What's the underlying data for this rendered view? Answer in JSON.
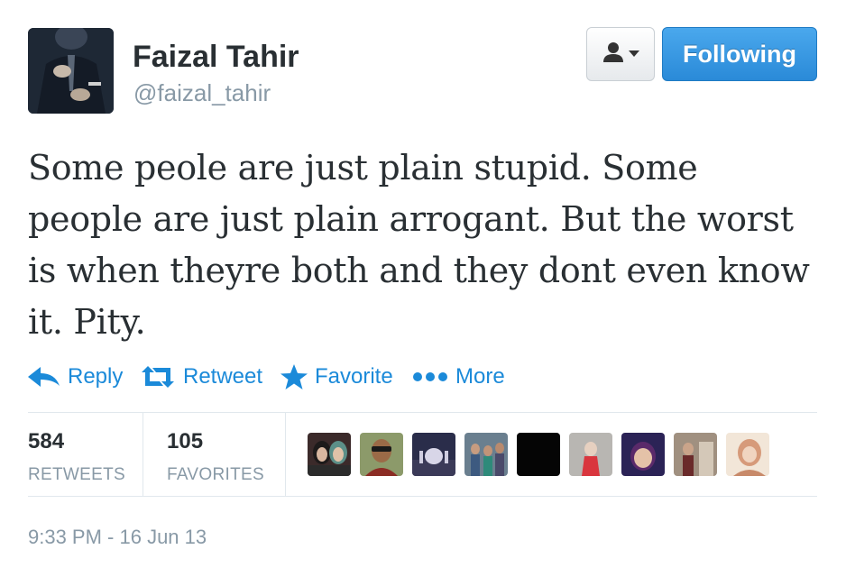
{
  "user": {
    "name": "Faizal Tahir",
    "handle": "@faizal_tahir"
  },
  "header": {
    "follow_label": "Following"
  },
  "tweet": {
    "text": "Some peole are just plain stupid. Some people are just plain arrogant. But the worst is when theyre both and they dont even know it. Pity."
  },
  "actions": {
    "reply": "Reply",
    "retweet": "Retweet",
    "favorite": "Favorite",
    "more": "More"
  },
  "stats": {
    "retweets_count": "584",
    "retweets_label": "RETWEETS",
    "favorites_count": "105",
    "favorites_label": "FAVORITES"
  },
  "timestamp": "9:33 PM - 16 Jun 13",
  "colors": {
    "accent": "#1b8ad9",
    "follow_button": "#2a8ad8",
    "muted": "#8899a6",
    "text": "#292f33"
  },
  "icons": {
    "reply": "reply-arrow-icon",
    "retweet": "retweet-icon",
    "favorite": "star-icon",
    "more": "dots-icon",
    "user_menu": "user-silhouette-icon"
  }
}
